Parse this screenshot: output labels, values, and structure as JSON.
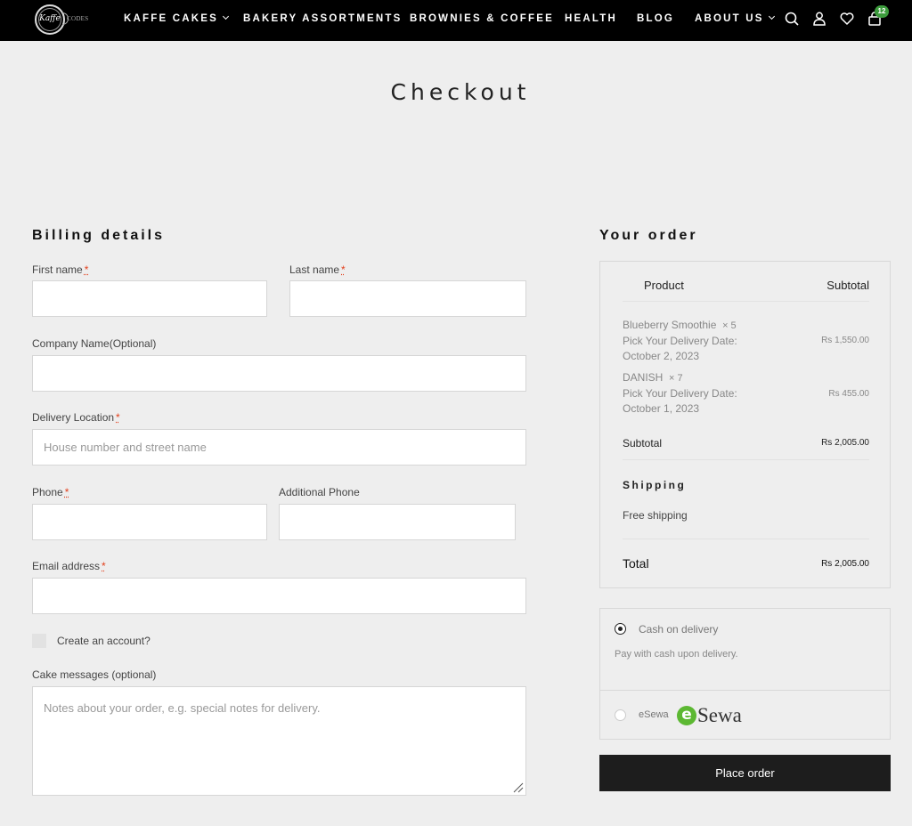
{
  "header": {
    "logo": {
      "mark": "Kaffe",
      "text": "CODES"
    },
    "nav": [
      {
        "label": "KAFFE CAKES",
        "has_dropdown": true
      },
      {
        "label": "BAKERY ASSORTMENTS",
        "has_dropdown": false
      },
      {
        "label": "BROWNIES & COFFEE",
        "has_dropdown": false
      },
      {
        "label": "HEALTH",
        "has_dropdown": false
      },
      {
        "label": "BLOG",
        "has_dropdown": false
      },
      {
        "label": "ABOUT US",
        "has_dropdown": true
      }
    ],
    "icons": [
      "search-icon",
      "user-icon",
      "heart-icon",
      "cart-icon"
    ],
    "cart_count": "12",
    "badge_color": "#3c9b3c"
  },
  "page": {
    "title": "Checkout"
  },
  "billing": {
    "title": "Billing details",
    "required_mark": "*",
    "fields": {
      "first_name": {
        "label": "First name",
        "value": "",
        "placeholder": ""
      },
      "last_name": {
        "label": "Last name",
        "value": "",
        "placeholder": ""
      },
      "company": {
        "label": "Company Name(Optional)",
        "value": "",
        "placeholder": ""
      },
      "delivery_location": {
        "label": "Delivery Location",
        "value": "",
        "placeholder": "House number and street name"
      },
      "phone": {
        "label": "Phone",
        "value": "",
        "placeholder": ""
      },
      "additional_phone": {
        "label": "Additional Phone",
        "value": "",
        "placeholder": ""
      },
      "email": {
        "label": "Email address",
        "value": "",
        "placeholder": ""
      }
    },
    "create_account": {
      "label": "Create an account?",
      "checked": false
    },
    "cake_messages": {
      "label": "Cake messages (optional)",
      "placeholder": "Notes about your order, e.g. special notes for delivery.",
      "value": ""
    }
  },
  "order": {
    "title": "Your order",
    "columns": {
      "product": "Product",
      "subtotal": "Subtotal"
    },
    "items": [
      {
        "name": "Blueberry Smoothie",
        "qty": "× 5",
        "meta_label": "Pick Your Delivery Date:",
        "meta_value": "October 2, 2023",
        "price": "Rs 1,550.00"
      },
      {
        "name": "DANISH",
        "qty": "× 7",
        "meta_label": "Pick Your Delivery Date:",
        "meta_value": "October 1, 2023",
        "price": "Rs 455.00"
      }
    ],
    "subtotal": {
      "label": "Subtotal",
      "value": "Rs 2,005.00"
    },
    "shipping": {
      "label": "Shipping",
      "value": "Free shipping"
    },
    "total": {
      "label": "Total",
      "value": "Rs 2,005.00"
    }
  },
  "payment": {
    "methods": [
      {
        "label": "Cash on delivery",
        "description": "Pay with cash upon delivery.",
        "selected": true
      },
      {
        "label": "eSewa",
        "logo_text": "Sewa",
        "logo_mark": "e",
        "selected": false,
        "brand_color": "#5cb832"
      }
    ],
    "place_order_label": "Place order"
  }
}
